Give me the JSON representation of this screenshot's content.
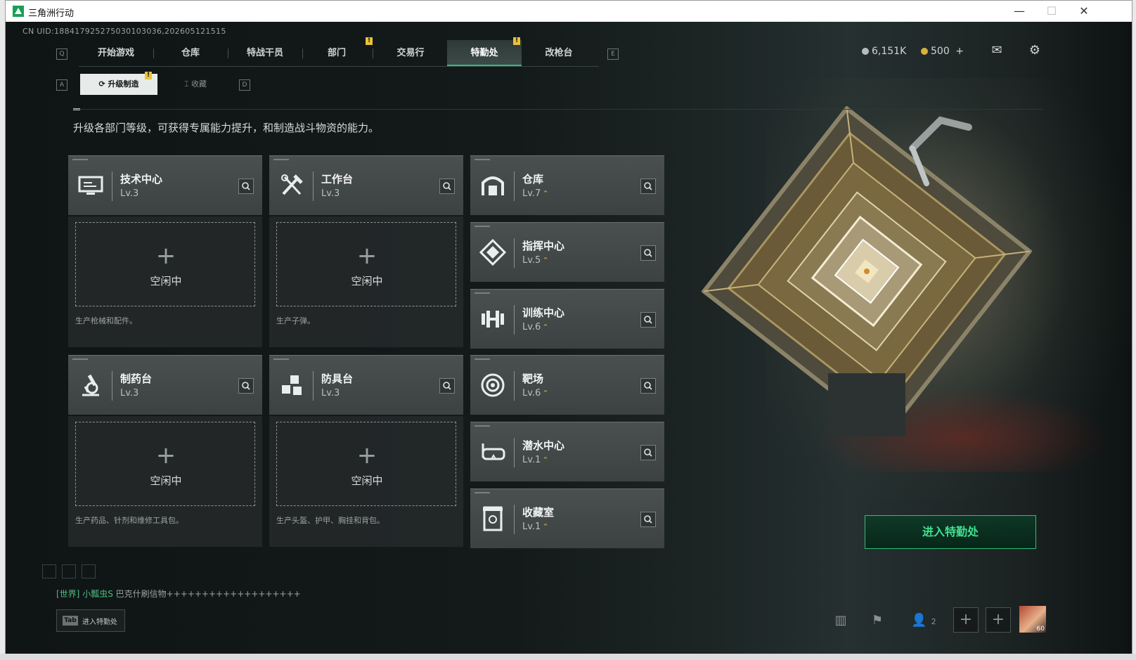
{
  "window": {
    "title": "三角洲行动",
    "minimize": "—",
    "maximize": "☐",
    "close": "✕"
  },
  "uid": "CN UID:188417925275030103036,202605121515",
  "nav": {
    "left_key": "Q",
    "right_key": "E",
    "tabs": [
      "开始游戏",
      "仓库",
      "特战干员",
      "部门",
      "交易行",
      "特勤处",
      "改枪台"
    ],
    "active_tab": "特勤处",
    "badges": {
      "部门": "!",
      "特勤处": "!"
    }
  },
  "resources": {
    "silver": "6,151K",
    "gold": "500",
    "gold_add": "+"
  },
  "top_icons": [
    "mail-icon",
    "gear-icon"
  ],
  "subtabs": {
    "left_key": "A",
    "right_key": "D",
    "active": "升级制造",
    "inactive": "收藏",
    "badge": "!"
  },
  "description": "升级各部门等级，可获得专属能力提升，和制造战斗物资的能力。",
  "stations": [
    {
      "name": "技术中心",
      "level": "Lv.3",
      "icon": "monitor-icon",
      "upgradable": false
    },
    {
      "name": "工作台",
      "level": "Lv.3",
      "icon": "tools-icon",
      "upgradable": false
    },
    {
      "name": "制药台",
      "level": "Lv.3",
      "icon": "microscope-icon",
      "upgradable": false
    },
    {
      "name": "防具台",
      "level": "Lv.3",
      "icon": "armor-icon",
      "upgradable": false
    }
  ],
  "slots": [
    {
      "plus": "+",
      "status": "空闲中",
      "desc": "生产枪械和配件。"
    },
    {
      "plus": "+",
      "status": "空闲中",
      "desc": "生产子弹。"
    },
    {
      "plus": "+",
      "status": "空闲中",
      "desc": "生产药品、针剂和维修工具包。"
    },
    {
      "plus": "+",
      "status": "空闲中",
      "desc": "生产头盔、护甲、胸挂和背包。"
    }
  ],
  "departments": [
    {
      "name": "仓库",
      "level": "Lv.7",
      "icon": "warehouse-icon",
      "up": "⌃"
    },
    {
      "name": "指挥中心",
      "level": "Lv.5",
      "icon": "command-icon",
      "up": "⌃"
    },
    {
      "name": "训练中心",
      "level": "Lv.6",
      "icon": "dumbbell-icon",
      "up": "⌃"
    },
    {
      "name": "靶场",
      "level": "Lv.6",
      "icon": "target-icon",
      "up": "⌃"
    },
    {
      "name": "潜水中心",
      "level": "Lv.1",
      "icon": "diving-mask-icon",
      "up": "⌃"
    },
    {
      "name": "收藏室",
      "level": "Lv.1",
      "icon": "collection-icon",
      "up": "⌃"
    }
  ],
  "enter_button": "进入特勤处",
  "chat": {
    "channel": "[世界]",
    "user": "小瓢虫S",
    "message": "巴克什刷信物+++++++++++++++++++"
  },
  "tab_hint": {
    "key": "Tab",
    "label": "进入特勤处"
  },
  "bottom": {
    "friends_count": "2",
    "avatar_level": "60"
  },
  "colors": {
    "accent": "#29c27a",
    "enter_text": "#3fe08e",
    "badge": "#e8c23a",
    "upgrade_arrow": "#d6b24a"
  }
}
